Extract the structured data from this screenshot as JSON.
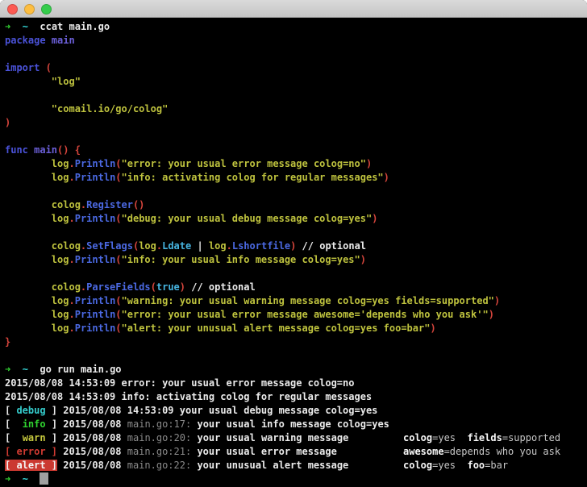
{
  "window": {
    "traffic_lights": [
      {
        "name": "close",
        "color": "#fc5a52"
      },
      {
        "name": "minimize",
        "color": "#fdbe41"
      },
      {
        "name": "zoom",
        "color": "#35cc4b"
      }
    ]
  },
  "colors": {
    "background": "#000000",
    "titlebar": "#cdcdcd",
    "green": "#32d132",
    "cyan": "#35d9d9",
    "white": "#ebebeb",
    "kw": "#4a52d8",
    "id": "#6b5fd8",
    "fn": "#4b69e2",
    "const": "#46b4e0",
    "yellow": "#bec23e",
    "punct": "#d6453c",
    "gray": "#8a8a8a",
    "key": "#f8f8f8",
    "value": "#c6c6c6",
    "debug": "#35cdcd",
    "info": "#2fd12f",
    "warn": "#c6c93e",
    "error": "#d23b32",
    "alert_bg": "#cb3931",
    "alert_fg": "#f5f5f5",
    "cursor": "#a0a0a0"
  },
  "normal_weight": [
    "gray",
    "value"
  ],
  "terminal": {
    "lines": [
      {
        "segments": [
          {
            "t": "➜",
            "s": "green",
            "n": "prompt-arrow-icon"
          },
          {
            "t": "  ",
            "s": "white"
          },
          {
            "t": "~",
            "s": "cyan",
            "n": "prompt-path"
          },
          {
            "t": "  ccat main.go",
            "s": "white",
            "n": "command-text"
          }
        ]
      },
      {
        "segments": [
          {
            "t": "package ",
            "s": "kw"
          },
          {
            "t": "main",
            "s": "id"
          }
        ]
      },
      {
        "segments": []
      },
      {
        "segments": [
          {
            "t": "import ",
            "s": "kw"
          },
          {
            "t": "(",
            "s": "punct"
          }
        ]
      },
      {
        "segments": [
          {
            "t": "        ",
            "s": "white"
          },
          {
            "t": "\"log\"",
            "s": "yellow"
          }
        ]
      },
      {
        "segments": []
      },
      {
        "segments": [
          {
            "t": "        ",
            "s": "white"
          },
          {
            "t": "\"comail.io/go/colog\"",
            "s": "yellow"
          }
        ]
      },
      {
        "segments": [
          {
            "t": ")",
            "s": "punct"
          }
        ]
      },
      {
        "segments": []
      },
      {
        "segments": [
          {
            "t": "func ",
            "s": "kw"
          },
          {
            "t": "main",
            "s": "id"
          },
          {
            "t": "() {",
            "s": "punct"
          }
        ]
      },
      {
        "segments": [
          {
            "t": "        ",
            "s": "white"
          },
          {
            "t": "log",
            "s": "yellow"
          },
          {
            "t": ".",
            "s": "punct"
          },
          {
            "t": "Println",
            "s": "fn"
          },
          {
            "t": "(",
            "s": "punct"
          },
          {
            "t": "\"error: your usual error message colog=no\"",
            "s": "yellow"
          },
          {
            "t": ")",
            "s": "punct"
          }
        ]
      },
      {
        "segments": [
          {
            "t": "        ",
            "s": "white"
          },
          {
            "t": "log",
            "s": "yellow"
          },
          {
            "t": ".",
            "s": "punct"
          },
          {
            "t": "Println",
            "s": "fn"
          },
          {
            "t": "(",
            "s": "punct"
          },
          {
            "t": "\"info: activating colog for regular messages\"",
            "s": "yellow"
          },
          {
            "t": ")",
            "s": "punct"
          }
        ]
      },
      {
        "segments": []
      },
      {
        "segments": [
          {
            "t": "        ",
            "s": "white"
          },
          {
            "t": "colog",
            "s": "yellow"
          },
          {
            "t": ".",
            "s": "punct"
          },
          {
            "t": "Register",
            "s": "fn"
          },
          {
            "t": "()",
            "s": "punct"
          }
        ]
      },
      {
        "segments": [
          {
            "t": "        ",
            "s": "white"
          },
          {
            "t": "log",
            "s": "yellow"
          },
          {
            "t": ".",
            "s": "punct"
          },
          {
            "t": "Println",
            "s": "fn"
          },
          {
            "t": "(",
            "s": "punct"
          },
          {
            "t": "\"debug: your usual debug message colog=yes\"",
            "s": "yellow"
          },
          {
            "t": ")",
            "s": "punct"
          }
        ]
      },
      {
        "segments": []
      },
      {
        "segments": [
          {
            "t": "        ",
            "s": "white"
          },
          {
            "t": "colog",
            "s": "yellow"
          },
          {
            "t": ".",
            "s": "punct"
          },
          {
            "t": "SetFlags",
            "s": "fn"
          },
          {
            "t": "(",
            "s": "punct"
          },
          {
            "t": "log",
            "s": "yellow"
          },
          {
            "t": ".",
            "s": "punct"
          },
          {
            "t": "Ldate",
            "s": "const"
          },
          {
            "t": " | ",
            "s": "white"
          },
          {
            "t": "log",
            "s": "yellow"
          },
          {
            "t": ".",
            "s": "punct"
          },
          {
            "t": "Lshortfile",
            "s": "fn"
          },
          {
            "t": ")",
            "s": "punct"
          },
          {
            "t": " // optional",
            "s": "white"
          }
        ]
      },
      {
        "segments": [
          {
            "t": "        ",
            "s": "white"
          },
          {
            "t": "log",
            "s": "yellow"
          },
          {
            "t": ".",
            "s": "punct"
          },
          {
            "t": "Println",
            "s": "fn"
          },
          {
            "t": "(",
            "s": "punct"
          },
          {
            "t": "\"info: your usual info message colog=yes\"",
            "s": "yellow"
          },
          {
            "t": ")",
            "s": "punct"
          }
        ]
      },
      {
        "segments": []
      },
      {
        "segments": [
          {
            "t": "        ",
            "s": "white"
          },
          {
            "t": "colog",
            "s": "yellow"
          },
          {
            "t": ".",
            "s": "punct"
          },
          {
            "t": "ParseFields",
            "s": "fn"
          },
          {
            "t": "(",
            "s": "punct"
          },
          {
            "t": "true",
            "s": "const"
          },
          {
            "t": ")",
            "s": "punct"
          },
          {
            "t": " // optional",
            "s": "white"
          }
        ]
      },
      {
        "segments": [
          {
            "t": "        ",
            "s": "white"
          },
          {
            "t": "log",
            "s": "yellow"
          },
          {
            "t": ".",
            "s": "punct"
          },
          {
            "t": "Println",
            "s": "fn"
          },
          {
            "t": "(",
            "s": "punct"
          },
          {
            "t": "\"warning: your usual warning message colog=yes fields=supported\"",
            "s": "yellow"
          },
          {
            "t": ")",
            "s": "punct"
          }
        ]
      },
      {
        "segments": [
          {
            "t": "        ",
            "s": "white"
          },
          {
            "t": "log",
            "s": "yellow"
          },
          {
            "t": ".",
            "s": "punct"
          },
          {
            "t": "Println",
            "s": "fn"
          },
          {
            "t": "(",
            "s": "punct"
          },
          {
            "t": "\"error: your usual error message awesome='depends who you ask'\"",
            "s": "yellow"
          },
          {
            "t": ")",
            "s": "punct"
          }
        ]
      },
      {
        "segments": [
          {
            "t": "        ",
            "s": "white"
          },
          {
            "t": "log",
            "s": "yellow"
          },
          {
            "t": ".",
            "s": "punct"
          },
          {
            "t": "Println",
            "s": "fn"
          },
          {
            "t": "(",
            "s": "punct"
          },
          {
            "t": "\"alert: your unusual alert message colog=yes foo=bar\"",
            "s": "yellow"
          },
          {
            "t": ")",
            "s": "punct"
          }
        ]
      },
      {
        "segments": [
          {
            "t": "}",
            "s": "punct"
          }
        ]
      },
      {
        "segments": []
      },
      {
        "segments": [
          {
            "t": "➜",
            "s": "green",
            "n": "prompt-arrow-icon"
          },
          {
            "t": "  ",
            "s": "white"
          },
          {
            "t": "~",
            "s": "cyan",
            "n": "prompt-path"
          },
          {
            "t": "  go run main.go",
            "s": "white",
            "n": "command-text"
          }
        ]
      },
      {
        "segments": [
          {
            "t": "2015/08/08 14:53:09 error: your usual error message colog=no",
            "s": "white"
          }
        ]
      },
      {
        "segments": [
          {
            "t": "2015/08/08 14:53:09 info: activating colog for regular messages",
            "s": "white"
          }
        ]
      },
      {
        "segments": [
          {
            "t": "[ ",
            "s": "white"
          },
          {
            "t": "debug",
            "s": "debug",
            "n": "log-level-badge"
          },
          {
            "t": " ] ",
            "s": "white"
          },
          {
            "t": "2015/08/08 14:53:09 your usual debug message colog=yes",
            "s": "white"
          }
        ]
      },
      {
        "segments": [
          {
            "t": "[  ",
            "s": "white"
          },
          {
            "t": "info",
            "s": "info",
            "n": "log-level-badge"
          },
          {
            "t": " ] ",
            "s": "white"
          },
          {
            "t": "2015/08/08 ",
            "s": "white"
          },
          {
            "t": "main.go:17:",
            "s": "gray",
            "n": "file-reference"
          },
          {
            "t": " your usual info message colog=yes",
            "s": "white"
          }
        ]
      },
      {
        "segments": [
          {
            "t": "[  ",
            "s": "white"
          },
          {
            "t": "warn",
            "s": "warn",
            "n": "log-level-badge"
          },
          {
            "t": " ] ",
            "s": "white"
          },
          {
            "t": "2015/08/08 ",
            "s": "white"
          },
          {
            "t": "main.go:20:",
            "s": "gray",
            "n": "file-reference"
          },
          {
            "t": " your usual warning message",
            "s": "white"
          }
        ],
        "fields": [
          {
            "t": "colog",
            "s": "key"
          },
          {
            "t": "=yes",
            "s": "value"
          },
          {
            "t": "  ",
            "s": "value"
          },
          {
            "t": "fields",
            "s": "key"
          },
          {
            "t": "=supported",
            "s": "value"
          }
        ]
      },
      {
        "segments": [
          {
            "t": "[ error ]",
            "s": "error",
            "n": "log-level-badge"
          },
          {
            "t": " 2015/08/08 ",
            "s": "white"
          },
          {
            "t": "main.go:21:",
            "s": "gray",
            "n": "file-reference"
          },
          {
            "t": " your usual error message",
            "s": "white"
          }
        ],
        "fields": [
          {
            "t": "awesome",
            "s": "key"
          },
          {
            "t": "=depends who you ask",
            "s": "value"
          }
        ]
      },
      {
        "segments": [
          {
            "t": "[ alert ]",
            "s": "alert",
            "n": "log-level-badge"
          },
          {
            "t": " 2015/08/08 ",
            "s": "white"
          },
          {
            "t": "main.go:22:",
            "s": "gray",
            "n": "file-reference"
          },
          {
            "t": " your unusual alert message",
            "s": "white"
          }
        ],
        "fields": [
          {
            "t": "colog",
            "s": "key"
          },
          {
            "t": "=yes",
            "s": "value"
          },
          {
            "t": "  ",
            "s": "value"
          },
          {
            "t": "foo",
            "s": "key"
          },
          {
            "t": "=bar",
            "s": "value"
          }
        ]
      },
      {
        "segments": [
          {
            "t": "➜",
            "s": "green",
            "n": "prompt-arrow-icon"
          },
          {
            "t": "  ",
            "s": "white"
          },
          {
            "t": "~",
            "s": "cyan",
            "n": "prompt-path"
          },
          {
            "t": "  ",
            "s": "white"
          },
          {
            "t": " ",
            "s": "cursor",
            "n": "text-cursor"
          }
        ]
      }
    ]
  }
}
